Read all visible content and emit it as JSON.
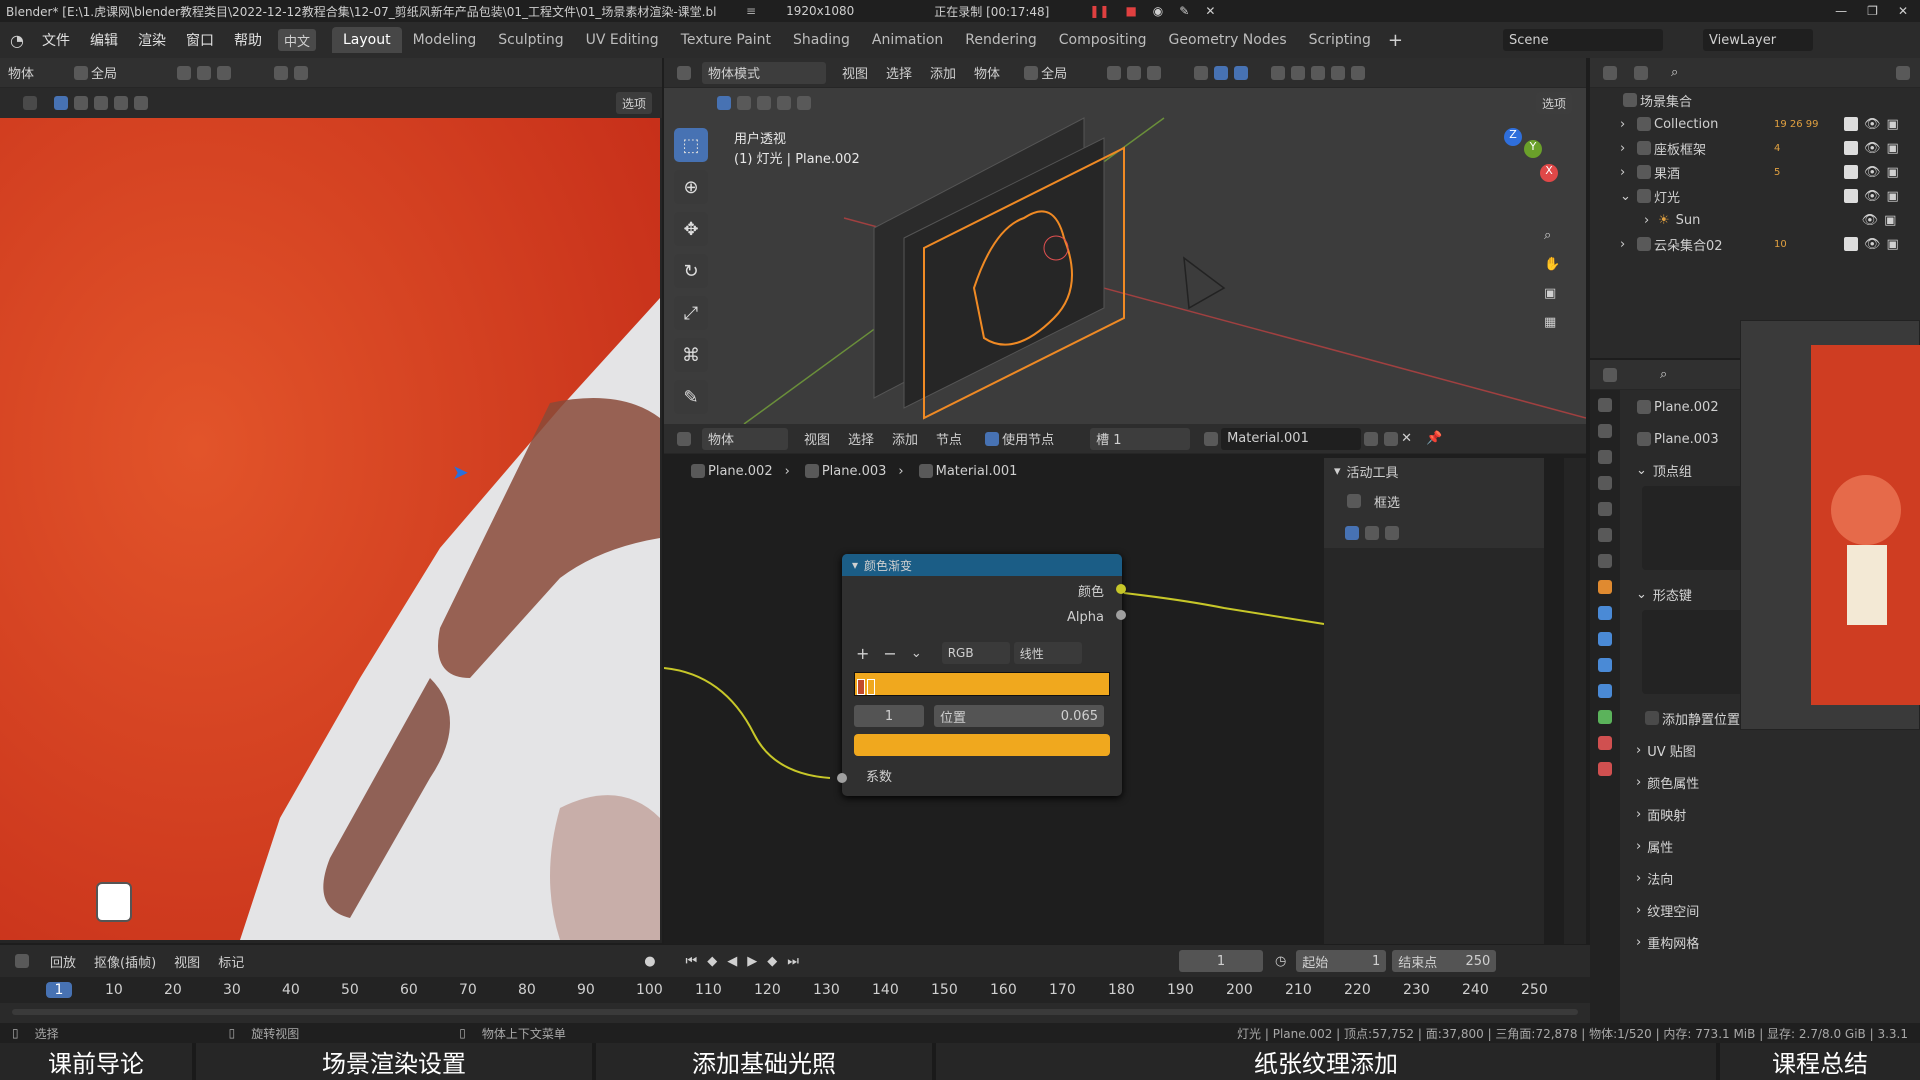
{
  "titlebar": {
    "title": "Blender* [E:\\1.虎课网\\blender教程类目\\2022-12-12教程合集\\12-07_剪纸风新年产品包装\\01_工程文件\\01_场景素材渲染-课堂.bl",
    "resolution": "1920x1080",
    "recording": "正在录制 [00:17:48]"
  },
  "menubar": {
    "items": [
      "文件",
      "编辑",
      "渲染",
      "窗口",
      "帮助"
    ],
    "lang": "中文",
    "workspaces": [
      "Layout",
      "Modeling",
      "Sculpting",
      "UV Editing",
      "Texture Paint",
      "Shading",
      "Animation",
      "Rendering",
      "Compositing",
      "Geometry Nodes",
      "Scripting"
    ],
    "active_workspace": "Layout",
    "scene": "Scene",
    "view_layer": "ViewLayer"
  },
  "left_editor": {
    "mode": "物体",
    "transform": "全局",
    "options": "选项"
  },
  "viewport": {
    "mode": "物体模式",
    "menus": [
      "视图",
      "选择",
      "添加",
      "物体"
    ],
    "transform": "全局",
    "options": "选项",
    "overlay_title": "用户透视",
    "overlay_sub": "(1) 灯光 | Plane.002"
  },
  "node_editor": {
    "mode": "物体",
    "menus": [
      "视图",
      "选择",
      "添加",
      "节点"
    ],
    "use_nodes": "使用节点",
    "slot": "槽 1",
    "material": "Material.001",
    "breadcrumb": [
      "Plane.002",
      "Plane.003",
      "Material.001"
    ],
    "node": {
      "title": "颜色渐变",
      "out_color": "颜色",
      "out_alpha": "Alpha",
      "mode": "RGB",
      "interp": "线性",
      "index": "1",
      "pos_label": "位置",
      "pos_value": "0.065",
      "in_fac": "系数"
    },
    "sidebar": {
      "panel": "活动工具",
      "tool": "框选"
    }
  },
  "outliner": {
    "root": "场景集合",
    "rows": [
      {
        "name": "Collection",
        "badge": "19 26 99"
      },
      {
        "name": "座板框架",
        "badge": "4"
      },
      {
        "name": "果酒",
        "badge": "5"
      },
      {
        "name": "灯光",
        "badge": ""
      },
      {
        "name": "Sun",
        "badge": ""
      },
      {
        "name": "云朵集合02",
        "badge": "10"
      }
    ]
  },
  "properties": {
    "object": "Plane.002",
    "mesh": "Plane.003",
    "sections_open": [
      "顶点组",
      "形态键"
    ],
    "add_rest": "添加静置位置",
    "sections": [
      "UV 贴图",
      "颜色属性",
      "面映射",
      "属性",
      "法向",
      "纹理空间",
      "重构网格"
    ]
  },
  "timeline": {
    "menus": [
      "回放",
      "抠像(插帧)",
      "视图",
      "标记"
    ],
    "current_frame": "1",
    "start_label": "起始",
    "start": "1",
    "end_label": "结束点",
    "end": "250",
    "ticks": [
      "1",
      "10",
      "20",
      "30",
      "40",
      "50",
      "60",
      "70",
      "80",
      "90",
      "100",
      "110",
      "120",
      "130",
      "140",
      "150",
      "160",
      "170",
      "180",
      "190",
      "200",
      "210",
      "220",
      "230",
      "240",
      "250"
    ]
  },
  "statusbar": {
    "left": "选择",
    "mid": "旋转视图",
    "ctx": "物体上下文菜单",
    "right": "灯光 | Plane.002 | 顶点:57,752 | 面:37,800 | 三角面:72,878 | 物体:1/520 | 内存: 773.1 MiB | 显存: 2.7/8.0 GiB | 3.3.1"
  },
  "chapters": [
    "课前导论",
    "场景渲染设置",
    "添加基础光照",
    "纸张纹理添加",
    "课程总结"
  ],
  "colors": {
    "accent": "#4772b3",
    "node_header": "#1b5d86",
    "gradient_orange": "#f0a81e",
    "socket_yellow": "#c7c729",
    "paper_red": "#d84420"
  }
}
